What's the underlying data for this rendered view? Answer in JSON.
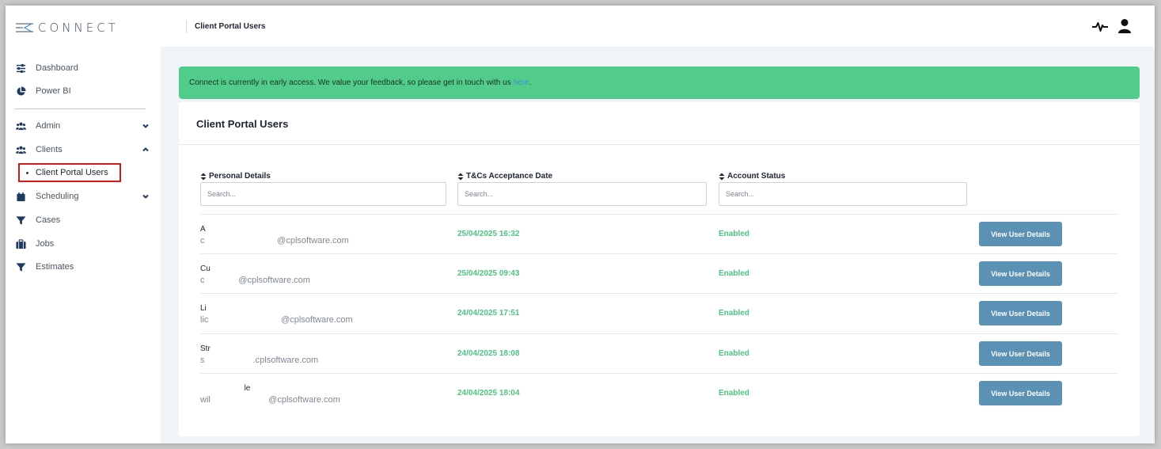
{
  "app": {
    "logo_text": "CONNECT"
  },
  "sidebar": {
    "items": [
      {
        "label": "Dashboard",
        "icon": "sliders-icon"
      },
      {
        "label": "Power BI",
        "icon": "pie-chart-icon"
      },
      {
        "label": "Admin",
        "icon": "users-icon",
        "expandable": true,
        "expanded": false
      },
      {
        "label": "Clients",
        "icon": "users-icon",
        "expandable": true,
        "expanded": true
      },
      {
        "label": "Scheduling",
        "icon": "calendar-icon",
        "expandable": true,
        "expanded": false
      },
      {
        "label": "Cases",
        "icon": "filter-icon"
      },
      {
        "label": "Jobs",
        "icon": "briefcase-icon"
      },
      {
        "label": "Estimates",
        "icon": "filter-icon"
      }
    ],
    "sub_item": {
      "label": "Client Portal Users",
      "selected": true
    }
  },
  "topbar": {
    "title": "Client Portal Users"
  },
  "banner": {
    "text": "Connect is currently in early access. We value your feedback, so please get in touch with us",
    "link": "here",
    "suffix": ".",
    "color": "#52cc8a"
  },
  "card": {
    "title": "Client Portal Users",
    "columns": [
      {
        "label": "Personal Details",
        "placeholder": "Search..."
      },
      {
        "label": "T&Cs Acceptance Date",
        "placeholder": "Search..."
      },
      {
        "label": "Account Status",
        "placeholder": "Search..."
      }
    ],
    "rows": [
      {
        "name": "A",
        "email": "c                              @cplsoftware.com",
        "date": "25/04/2025 16:32",
        "status": "Enabled",
        "action": "View User Details"
      },
      {
        "name": "Cu",
        "email": "c              @cplsoftware.com",
        "date": "25/04/2025 09:43",
        "status": "Enabled",
        "action": "View User Details"
      },
      {
        "name": "Li",
        "email": "lic                              @cplsoftware.com",
        "date": "24/04/2025 17:51",
        "status": "Enabled",
        "action": "View User Details"
      },
      {
        "name": "Str",
        "email": "s                    .cplsoftware.com",
        "date": "24/04/2025 18:08",
        "status": "Enabled",
        "action": "View User Details"
      },
      {
        "name": "                    le",
        "email": "wil                        @cplsoftware.com",
        "date": "24/04/2025 18:04",
        "status": "Enabled",
        "action": "View User Details"
      }
    ]
  },
  "colors": {
    "accent": "#5b91b5",
    "success": "#4cc482",
    "nav_icon": "#1e3a5f",
    "highlight_border": "#d11a1a"
  }
}
